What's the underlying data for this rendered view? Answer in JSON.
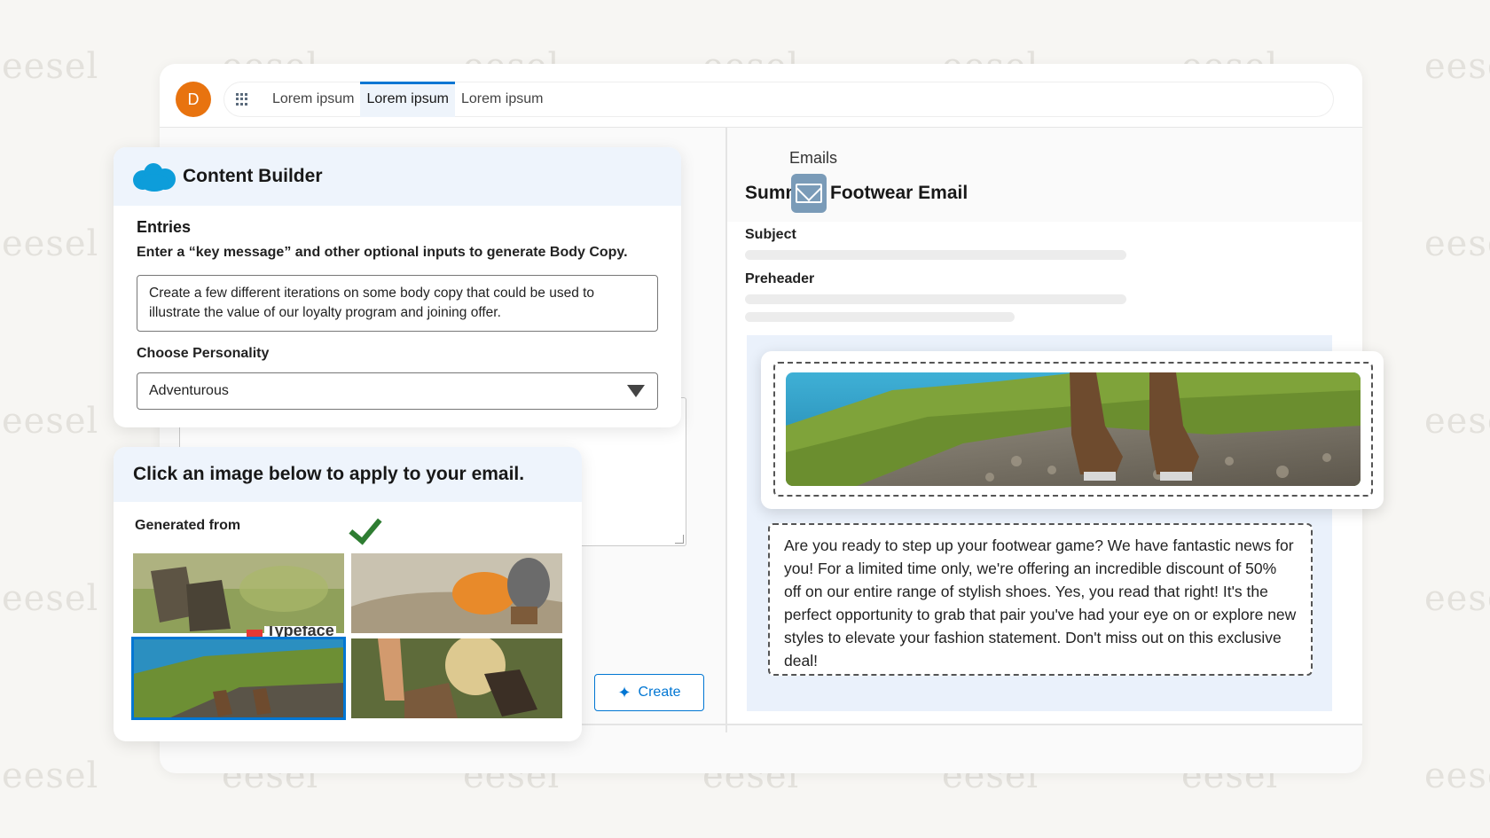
{
  "watermark": "eesel",
  "user": {
    "avatar_initial": "D"
  },
  "tabs": [
    {
      "label": "Lorem ipsum",
      "active": false
    },
    {
      "label": "Lorem ipsum",
      "active": true
    },
    {
      "label": "Lorem ipsum",
      "active": false
    }
  ],
  "content_builder": {
    "title": "Content Builder",
    "entries_label": "Entries",
    "help_text": "Enter a “key message” and other optional inputs to generate Body Copy.",
    "message_value": "Create a few different iterations on some body copy that could be used to illustrate the value of our loyalty program and joining offer.",
    "personality_label": "Choose Personality",
    "personality_value": "Adventurous"
  },
  "image_picker": {
    "heading": "Click an image below to apply to your email.",
    "generated_from_label": "Generated from",
    "typeface_label": "Typeface",
    "images": [
      {
        "name": "hiking-boots-grass",
        "selected": false
      },
      {
        "name": "backpack-gear-rocks",
        "selected": false
      },
      {
        "name": "boots-on-mountain-lake",
        "selected": true
      },
      {
        "name": "hiker-tying-boots",
        "selected": false
      }
    ]
  },
  "create_button": {
    "label": "Create",
    "icon": "sparkle-icon"
  },
  "email": {
    "breadcrumb": "Emails",
    "title_prefix": "Summ",
    "title_suffix": "Footwear Email",
    "subject_label": "Subject",
    "preheader_label": "Preheader",
    "body_copy": "Are you ready to step up your footwear game? We have fantastic news for you! For a limited time only, we're offering an incredible discount of 50% off on our entire range of stylish shoes. Yes, you read that right! It's the perfect opportunity to grab that pair you've had your eye on or explore new styles to elevate your fashion statement. Don't miss out on this exclusive deal!"
  },
  "colors": {
    "accent": "#0176d3",
    "avatar": "#e8730f",
    "cloud": "#0d9dda",
    "check": "#2e7d32"
  }
}
